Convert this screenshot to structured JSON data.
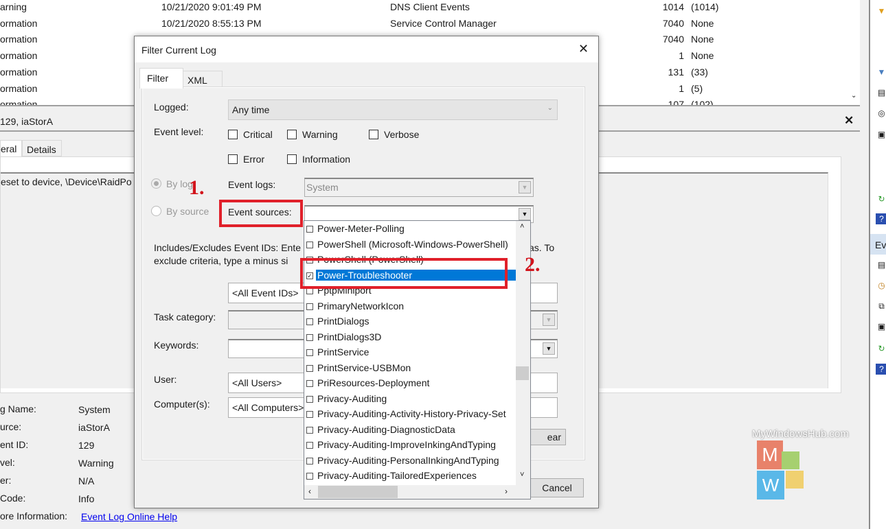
{
  "events": [
    {
      "level": "arning",
      "date": "10/21/2020 9:01:49 PM",
      "source": "DNS Client Events",
      "id": "1014",
      "task": "(1014)"
    },
    {
      "level": "ormation",
      "date": "10/21/2020 8:55:13 PM",
      "source": "Service Control Manager",
      "id": "7040",
      "task": "None"
    },
    {
      "level": "ormation",
      "date": "",
      "source": "",
      "id": "7040",
      "task": "None"
    },
    {
      "level": "ormation",
      "date": "",
      "source": "",
      "id": "1",
      "task": "None"
    },
    {
      "level": "ormation",
      "date": "",
      "source": "",
      "id": "131",
      "task": "(33)"
    },
    {
      "level": "ormation",
      "date": "",
      "source": "",
      "id": "1",
      "task": "(5)"
    },
    {
      "level": "ormation",
      "date": "",
      "source": "",
      "id": "107",
      "task": "(102)"
    }
  ],
  "detail": {
    "title": "129, iaStorA",
    "tabs": [
      "eral",
      "Details"
    ],
    "description": "eset to device, \\Device\\RaidPo",
    "fields": [
      {
        "label": "g Name:",
        "value": "System"
      },
      {
        "label": "urce:",
        "value": "iaStorA"
      },
      {
        "label": "ent ID:",
        "value": "129"
      },
      {
        "label": "vel:",
        "value": "Warning"
      },
      {
        "label": "er:",
        "value": "N/A"
      },
      {
        "label": "Code:",
        "value": "Info"
      },
      {
        "label": "ore Information:",
        "value": "Event Log Online Help"
      }
    ]
  },
  "actions_panel": {
    "section": "Ev"
  },
  "dialog": {
    "title": "Filter Current Log",
    "tabs": [
      "Filter",
      "XML"
    ],
    "logged_label": "Logged:",
    "logged_value": "Any time",
    "event_level_label": "Event level:",
    "levels": [
      {
        "label": "Critical",
        "checked": false
      },
      {
        "label": "Warning",
        "checked": false
      },
      {
        "label": "Verbose",
        "checked": false
      },
      {
        "label": "Error",
        "checked": false
      },
      {
        "label": "Information",
        "checked": false
      }
    ],
    "by_log": "By log",
    "by_source": "By source",
    "event_logs_label": "Event logs:",
    "event_logs_value": "System",
    "event_sources_label": "Event sources:",
    "ids_text_1": "Includes/Excludes Event IDs: Ente",
    "ids_text_1b": "as. To",
    "ids_text_2": "exclude criteria, type a minus si",
    "event_ids_value": "<All Event IDs>",
    "task_category_label": "Task category:",
    "keywords_label": "Keywords:",
    "user_label": "User:",
    "user_value": "<All Users>",
    "computers_label": "Computer(s):",
    "computers_value": "<All Computers>",
    "clear_label": "ear",
    "cancel_label": "Cancel",
    "sources": [
      {
        "label": "Power-Meter-Polling",
        "checked": false
      },
      {
        "label": "PowerShell (Microsoft-Windows-PowerShell)",
        "checked": false
      },
      {
        "label": "PowerShell (PowerShell)",
        "checked": false
      },
      {
        "label": "Power-Troubleshooter",
        "checked": true,
        "selected": true
      },
      {
        "label": "PptpMiniport",
        "checked": false
      },
      {
        "label": "PrimaryNetworkIcon",
        "checked": false
      },
      {
        "label": "PrintDialogs",
        "checked": false
      },
      {
        "label": "PrintDialogs3D",
        "checked": false
      },
      {
        "label": "PrintService",
        "checked": false
      },
      {
        "label": "PrintService-USBMon",
        "checked": false
      },
      {
        "label": "PriResources-Deployment",
        "checked": false
      },
      {
        "label": "Privacy-Auditing",
        "checked": false
      },
      {
        "label": "Privacy-Auditing-Activity-History-Privacy-Set",
        "checked": false
      },
      {
        "label": "Privacy-Auditing-DiagnosticData",
        "checked": false
      },
      {
        "label": "Privacy-Auditing-ImproveInkingAndTyping",
        "checked": false
      },
      {
        "label": "Privacy-Auditing-PersonalInkingAndTyping",
        "checked": false
      },
      {
        "label": "Privacy-Auditing-TailoredExperiences",
        "checked": false
      }
    ]
  },
  "annotations": {
    "step1": "1.",
    "step2": "2.",
    "annotation_color": "#e0202a"
  },
  "watermark": {
    "text": "MyWindowsHub.com",
    "letters": "MW"
  },
  "colors": {
    "selection": "#0078d7",
    "link": "#0000ee"
  }
}
